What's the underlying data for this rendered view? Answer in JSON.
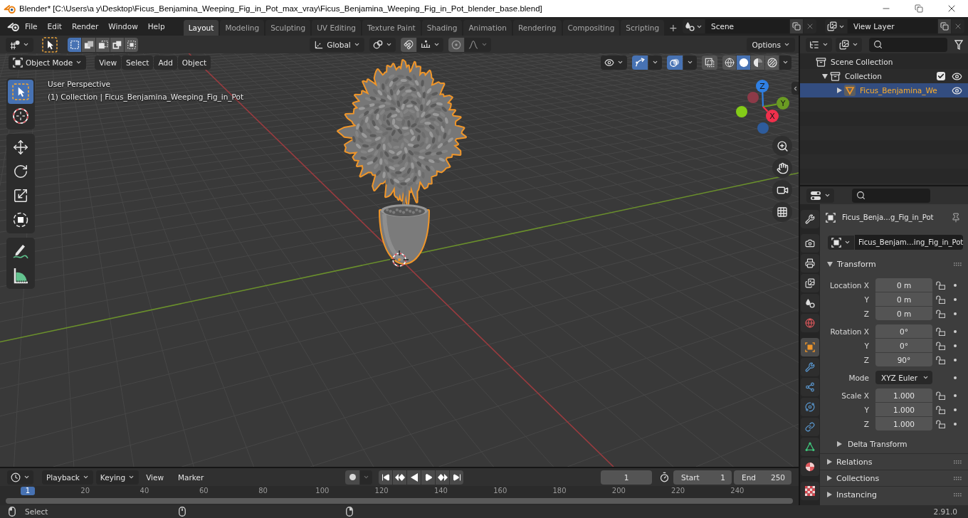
{
  "window": {
    "title": "Blender* [C:\\Users\\a y\\Desktop\\Ficus_Benjamina_Weeping_Fig_in_Pot_max_vray\\Ficus_Benjamina_Weeping_Fig_in_Pot_blender_base.blend]"
  },
  "top_bar": {
    "menus": [
      "File",
      "Edit",
      "Render",
      "Window",
      "Help"
    ],
    "workspaces": [
      {
        "label": "Layout",
        "selected": true
      },
      {
        "label": "Modeling",
        "selected": false
      },
      {
        "label": "Sculpting",
        "selected": false
      },
      {
        "label": "UV Editing",
        "selected": false
      },
      {
        "label": "Texture Paint",
        "selected": false
      },
      {
        "label": "Shading",
        "selected": false
      },
      {
        "label": "Animation",
        "selected": false
      },
      {
        "label": "Rendering",
        "selected": false
      },
      {
        "label": "Compositing",
        "selected": false
      },
      {
        "label": "Scripting",
        "selected": false
      }
    ],
    "add_workspace": "+",
    "scene": {
      "value": "Scene"
    },
    "view_layer": {
      "value": "View Layer"
    }
  },
  "tool_header": {
    "select_modes": [
      {
        "selected": true
      },
      {
        "selected": false
      },
      {
        "selected": false
      },
      {
        "selected": false
      },
      {
        "selected": false
      }
    ],
    "orientation": "Global",
    "snap": {
      "on": false
    },
    "proportional_editing": {
      "on": false
    },
    "options": "Options"
  },
  "viewport_header": {
    "mode": "Object Mode",
    "menus": [
      "View",
      "Select",
      "Add",
      "Object"
    ],
    "gizmos": {
      "on": true
    },
    "overlays": {
      "on": true
    },
    "xray": {
      "on": false
    },
    "shading": [
      {
        "selected": false
      },
      {
        "selected": true
      },
      {
        "selected": false
      },
      {
        "selected": false
      }
    ]
  },
  "viewport": {
    "toolbar": [
      {
        "tools": [
          {
            "selected": true
          },
          {
            "selected": false
          }
        ]
      },
      {
        "tools": [
          {
            "selected": false
          },
          {
            "selected": false
          },
          {
            "selected": false
          },
          {
            "selected": false
          }
        ]
      },
      {
        "tools": [
          {
            "selected": false
          },
          {
            "selected": false
          }
        ]
      }
    ],
    "info": [
      "User Perspective",
      "(1) Collection | Ficus_Benjamina_Weeping_Fig_in_Pot"
    ],
    "navigation_gizmo": {
      "axes": [
        {
          "label": "Z",
          "color": "#2f80e4"
        },
        {
          "label": "Y",
          "color": "#6a9b22"
        },
        {
          "label": "X",
          "color": "#f0304c"
        }
      ]
    }
  },
  "outliner": {
    "tree": [
      {
        "label": "Scene Collection",
        "selected": false,
        "children": [
          {
            "label": "Collection",
            "selected": false,
            "expanded": true,
            "checked": true,
            "visible": true,
            "children": [
              {
                "label": "Ficus_Benjamina_We",
                "selected": true,
                "expanded": false,
                "visible": true
              }
            ]
          }
        ]
      }
    ]
  },
  "properties": {
    "tab_groups": [
      {
        "tabs": [
          {
            "selected": false
          }
        ]
      },
      {
        "tabs": [
          {
            "selected": false
          },
          {
            "selected": false
          },
          {
            "selected": false
          },
          {
            "selected": false
          },
          {
            "selected": false
          }
        ]
      },
      {
        "tabs": [
          {
            "selected": true
          },
          {
            "selected": false
          },
          {
            "selected": false
          },
          {
            "selected": false
          },
          {
            "selected": false
          },
          {
            "selected": false
          },
          {
            "selected": false
          }
        ]
      },
      {
        "tabs": [
          {
            "selected": false
          }
        ]
      }
    ],
    "object_name": "Ficus_Benja…g_Fig_in_Pot",
    "data_name": "Ficus_Benjam…ing_Fig_in_Pot",
    "transform": {
      "title": "Transform",
      "expanded": true,
      "groups": [
        {
          "rows": [
            {
              "kind": "number",
              "label": "Location X",
              "value": "0 m",
              "locked": false
            },
            {
              "kind": "number",
              "label": "Y",
              "value": "0 m",
              "locked": false
            },
            {
              "kind": "number",
              "label": "Z",
              "value": "0 m",
              "locked": false
            }
          ]
        },
        {
          "rows": [
            {
              "kind": "number",
              "label": "Rotation X",
              "value": "0°",
              "locked": false
            },
            {
              "kind": "number",
              "label": "Y",
              "value": "0°",
              "locked": false
            },
            {
              "kind": "number",
              "label": "Z",
              "value": "90°",
              "locked": false
            }
          ]
        },
        {
          "rows": [
            {
              "kind": "dropdown",
              "label": "Mode",
              "value": "XYZ Euler"
            }
          ]
        },
        {
          "rows": [
            {
              "kind": "number",
              "label": "Scale X",
              "value": "1.000",
              "locked": false
            },
            {
              "kind": "number",
              "label": "Y",
              "value": "1.000",
              "locked": false
            },
            {
              "kind": "number",
              "label": "Z",
              "value": "1.000",
              "locked": false
            }
          ]
        }
      ],
      "subpanels": [
        {
          "title": "Delta Transform",
          "expanded": false
        }
      ]
    },
    "panels": [
      {
        "title": "Relations",
        "expanded": false
      },
      {
        "title": "Collections",
        "expanded": false
      },
      {
        "title": "Instancing",
        "expanded": false
      }
    ]
  },
  "timeline": {
    "menus": [
      {
        "label": "Playback",
        "dropdown": true
      },
      {
        "label": "Keying",
        "dropdown": true
      },
      {
        "label": "View",
        "dropdown": false
      },
      {
        "label": "Marker",
        "dropdown": false
      }
    ],
    "auto_keying": {
      "on": false
    },
    "current_frame": "1",
    "start": {
      "label": "Start",
      "value": "1"
    },
    "end": {
      "label": "End",
      "value": "250"
    },
    "ruler": [
      {
        "label": "1",
        "selected": true
      },
      {
        "label": "20",
        "selected": false
      },
      {
        "label": "40",
        "selected": false
      },
      {
        "label": "60",
        "selected": false
      },
      {
        "label": "80",
        "selected": false
      },
      {
        "label": "100",
        "selected": false
      },
      {
        "label": "120",
        "selected": false
      },
      {
        "label": "140",
        "selected": false
      },
      {
        "label": "160",
        "selected": false
      },
      {
        "label": "180",
        "selected": false
      },
      {
        "label": "200",
        "selected": false
      },
      {
        "label": "220",
        "selected": false
      },
      {
        "label": "240",
        "selected": false
      }
    ]
  },
  "status_bar": {
    "hints": [
      {
        "label": "Select"
      }
    ],
    "version": "2.91.0"
  }
}
